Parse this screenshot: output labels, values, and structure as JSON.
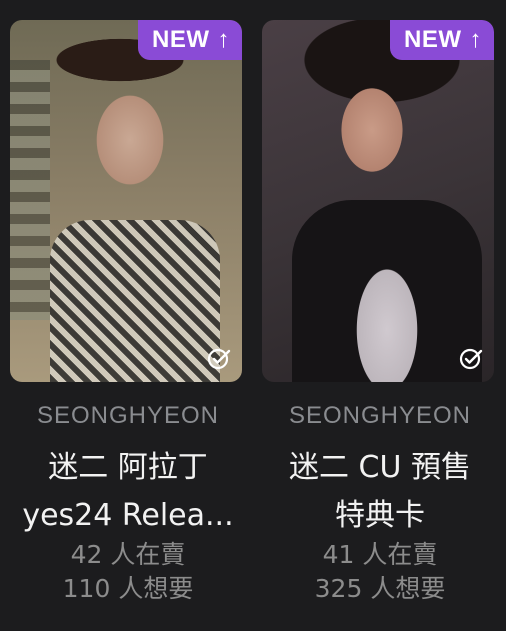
{
  "cards": [
    {
      "badge": "NEW",
      "group": "SEONGHYEON",
      "title_line1": "迷二 阿拉丁",
      "title_line2": "yes24 Relea...",
      "selling": "42 人在賣",
      "wanting": "110 人想要"
    },
    {
      "badge": "NEW",
      "group": "SEONGHYEON",
      "title_line1": "迷二 CU 預售",
      "title_line2": "特典卡",
      "selling": "41 人在賣",
      "wanting": "325 人想要"
    }
  ],
  "colors": {
    "background": "#1c1c1e",
    "badge": "#8a4bd6",
    "group_text": "#8a8c90",
    "title_text": "#f2f2f2",
    "stats_text": "#8c8c8c"
  },
  "icons": {
    "badge_arrow": "arrow-up-icon",
    "selected": "check-circle-icon"
  }
}
